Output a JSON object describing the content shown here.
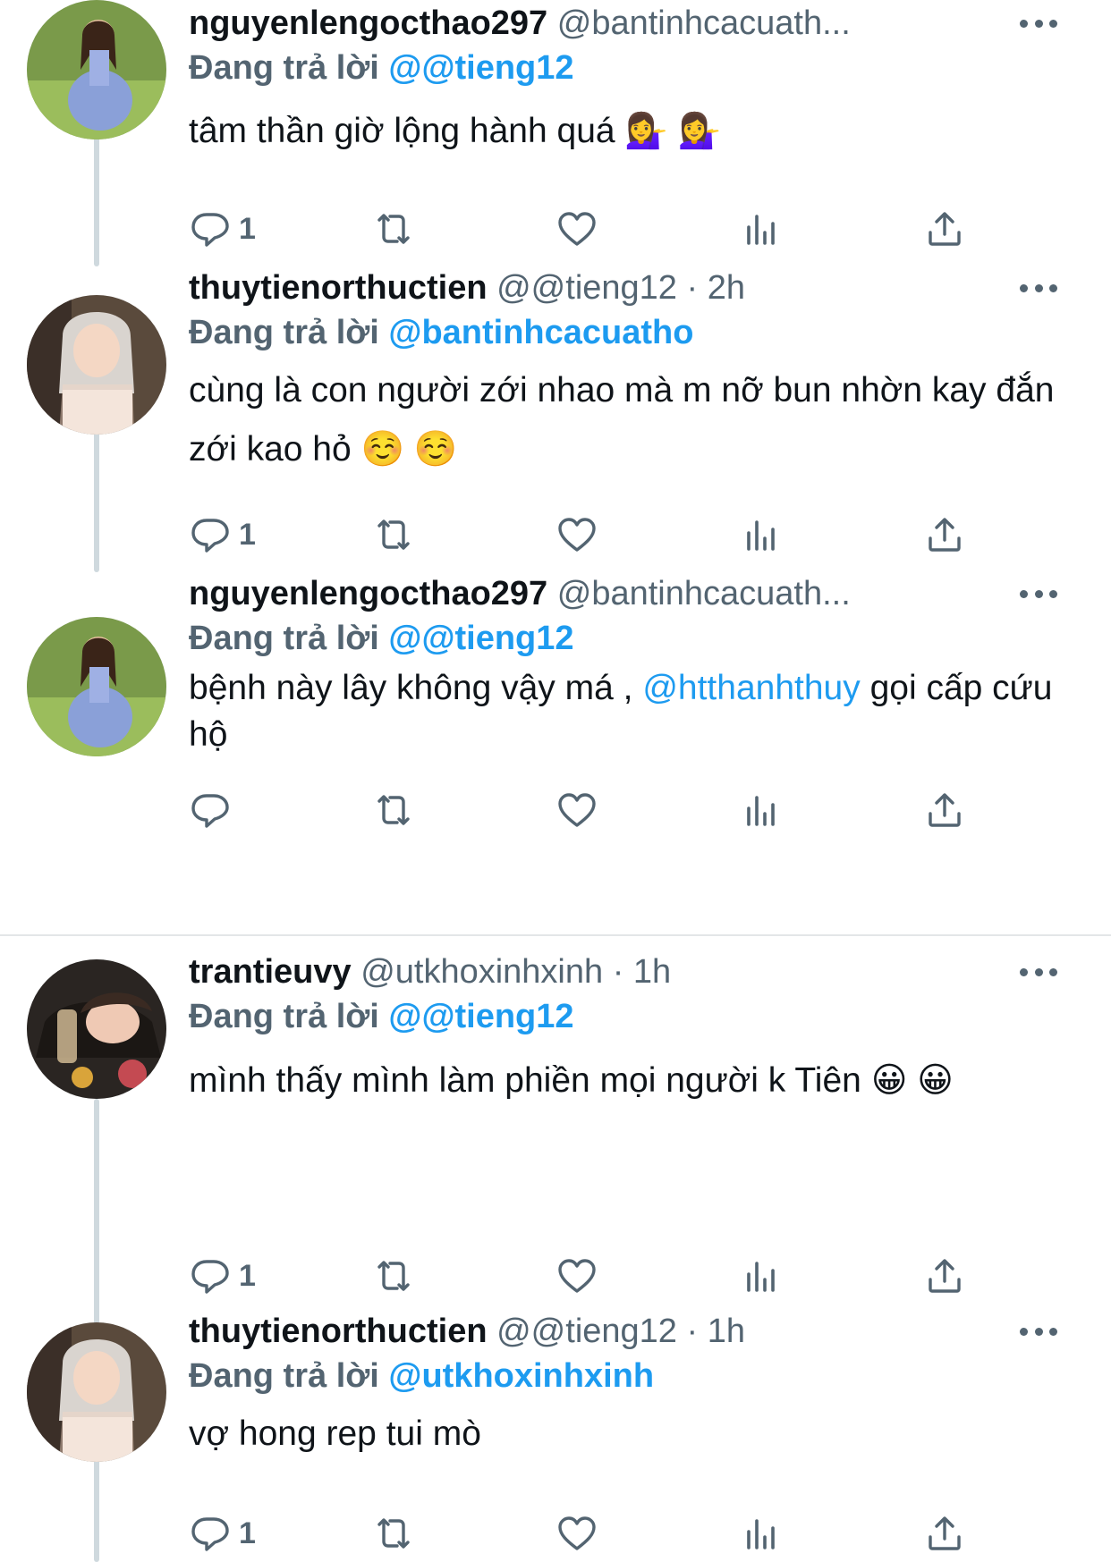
{
  "tweets": [
    {
      "name": "nguyenlengocthao297",
      "handle": "@bantinhcacuath...",
      "replying_prefix": "Đang trả lời",
      "replying_to": "@@tieng12",
      "text": "tâm thần giờ lộng hành quá 💁‍♀️ 💁‍♀️",
      "reply_count": "1"
    },
    {
      "name": "thuytienorthuctien",
      "handle": "@@tieng12 · 2h",
      "replying_prefix": "Đang trả lời",
      "replying_to": "@bantinhcacuatho",
      "text": "cùng là con người zới nhao mà m nỡ bun nhờn kay đắn zới kao hỏ ☺️ ☺️",
      "reply_count": "1"
    },
    {
      "name": "nguyenlengocthao297",
      "handle": "@bantinhcacuath...",
      "replying_prefix": "Đang trả lời",
      "replying_to": "@@tieng12",
      "text_before": "bệnh này lây không vậy má , ",
      "text_link": "@htthanhthuy",
      "text_after": " gọi cấp cứu hộ",
      "reply_count": ""
    },
    {
      "name": "trantieuvy",
      "handle": "@utkhoxinhxinh · 1h",
      "replying_prefix": "Đang trả lời",
      "replying_to": "@@tieng12",
      "text": "mình thấy mình làm phiền mọi người k Tiên 😀 😀",
      "reply_count": "1"
    },
    {
      "name": "thuytienorthuctien",
      "handle": "@@tieng12 · 1h",
      "replying_prefix": "Đang trả lời",
      "replying_to": "@utkhoxinhxinh",
      "text": "vợ hong rep tui mò",
      "reply_count": "1"
    }
  ],
  "icons": {
    "more": "more-icon",
    "reply": "reply-icon",
    "retweet": "retweet-icon",
    "like": "heart-icon",
    "views": "views-icon",
    "share": "share-icon"
  },
  "colors": {
    "link": "#1d9bf0",
    "secondary": "#536471",
    "text": "#0f1419",
    "thread_line": "#cfd9de"
  }
}
